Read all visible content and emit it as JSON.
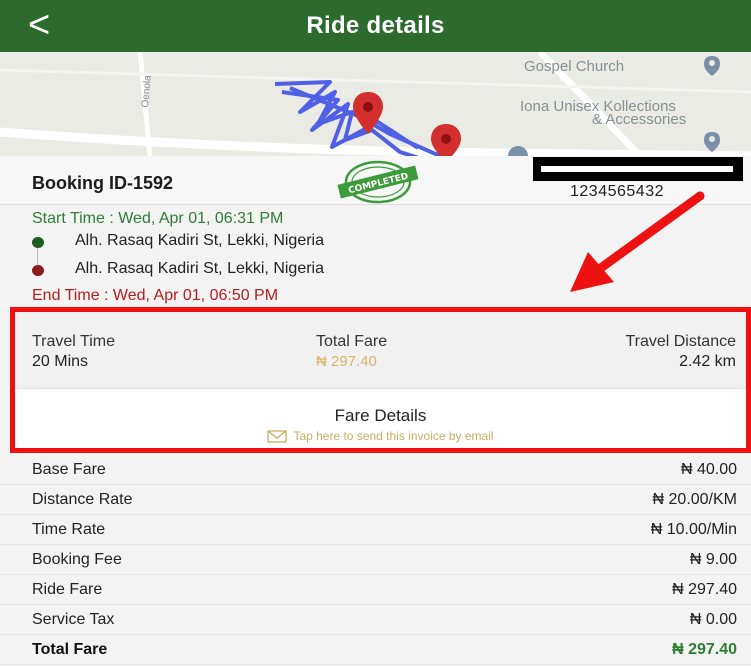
{
  "header": {
    "title": "Ride details",
    "back_icon": "chevron-left-icon",
    "color": "#2d6a2e"
  },
  "map": {
    "labels": [
      "Gospel Church",
      "Iona Unisex Kollections",
      "& Accessories"
    ],
    "road_label": "Oenola"
  },
  "booking": {
    "id_label": "Booking ID-1592",
    "stamp_text": "COMPLETED",
    "phone": "1234565432"
  },
  "route": {
    "start_time": "Start Time : Wed, Apr 01, 06:31 PM",
    "pickup_address": "Alh. Rasaq Kadiri St, Lekki, Nigeria",
    "dropoff_address": "Alh. Rasaq Kadiri St, Lekki, Nigeria",
    "end_time": "End Time : Wed, Apr 01, 06:50 PM"
  },
  "summary": {
    "travel_time_label": "Travel Time",
    "travel_time_value": "20 Mins",
    "total_fare_label": "Total Fare",
    "total_fare_value": "₦ 297.40",
    "travel_distance_label": "Travel Distance",
    "travel_distance_value": "2.42 km",
    "fare_details_title": "Fare Details",
    "email_link_text": "Tap here to send this invoice by email"
  },
  "fares": {
    "base_fare": {
      "label": "Base Fare",
      "amount": "₦ 40.00"
    },
    "distance_rate": {
      "label": "Distance Rate",
      "amount": "₦ 20.00/KM"
    },
    "time_rate": {
      "label": "Time Rate",
      "amount": "₦ 10.00/Min"
    },
    "booking_fee": {
      "label": "Booking Fee",
      "amount": "₦ 9.00"
    },
    "ride_fare": {
      "label": "Ride Fare",
      "amount": "₦ 297.40"
    },
    "service_tax": {
      "label": "Service Tax",
      "amount": "₦ 0.00"
    },
    "total_fare": {
      "label": "Total Fare",
      "amount": "₦ 297.40"
    }
  },
  "colors": {
    "primary_green": "#2d6a2e",
    "highlight_red": "#ee1111",
    "fare_gold": "#d7b46a",
    "end_red": "#b71c1c"
  }
}
